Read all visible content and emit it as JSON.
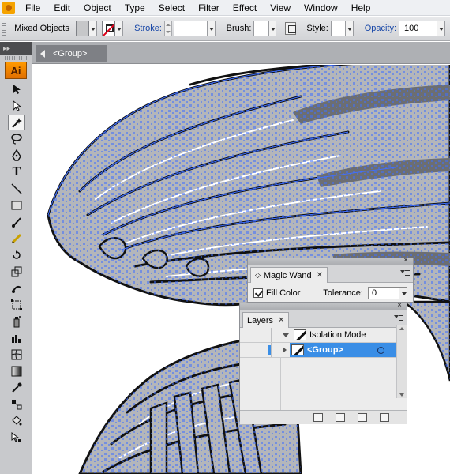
{
  "app": {
    "menu": [
      "File",
      "Edit",
      "Object",
      "Type",
      "Select",
      "Filter",
      "Effect",
      "View",
      "Window",
      "Help"
    ]
  },
  "control_bar": {
    "selection_label": "Mixed Objects",
    "stroke_label": "Stroke:",
    "brush_label": "Brush:",
    "style_label": "Style:",
    "opacity_label": "Opacity:",
    "opacity_value": "100"
  },
  "toolbar": {
    "logo": "Ai",
    "tools": [
      "selection",
      "direct-selection",
      "magic-wand",
      "lasso",
      "pen",
      "type",
      "line-segment",
      "rectangle",
      "paintbrush",
      "pencil",
      "rotate",
      "scale",
      "warp",
      "free-transform",
      "symbol-sprayer",
      "column-graph",
      "mesh",
      "gradient",
      "eyedropper",
      "blend",
      "live-paint-bucket",
      "live-paint-selection"
    ],
    "active_tool": "magic-wand"
  },
  "document": {
    "breadcrumb": "<Group>"
  },
  "magic_wand_panel": {
    "title": "Magic Wand",
    "fill_color_label": "Fill Color",
    "fill_color_checked": true,
    "tolerance_label": "Tolerance:",
    "tolerance_value": "0"
  },
  "layers_panel": {
    "title": "Layers",
    "rows": [
      {
        "name": "Isolation Mode",
        "expanded": true,
        "selected": false
      },
      {
        "name": "<Group>",
        "expanded": false,
        "selected": true
      }
    ]
  },
  "colors": {
    "accent": "#3a8ee6",
    "path_handles": "#3f6fff",
    "feather_fill": "#b4b6ba",
    "feather_dark": "#6c6e72"
  }
}
